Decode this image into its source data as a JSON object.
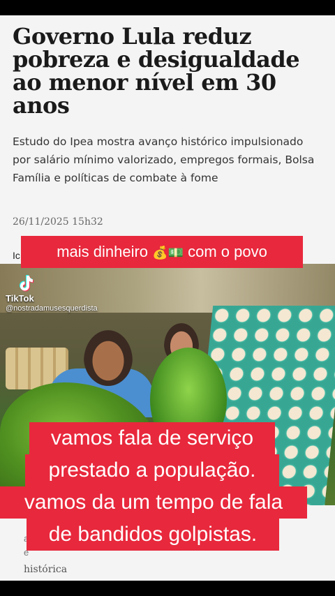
{
  "article": {
    "headline": "Governo Lula reduz pobreza e desigualdade ao menor nível em 30 anos",
    "subtitle": "Estudo do Ipea mostra avanço histórico impulsionado por salário mínimo valorizado, empregos formais, Bolsa Família e políticas de combate à fome",
    "date": "26/11/2025 15h32",
    "truncated_left": "Ic",
    "lower_text_fragment": "histórica"
  },
  "overlay": {
    "top_caption_pre": "mais dinheiro ",
    "top_caption_emoji": "💰💵",
    "top_caption_post": " com o povo",
    "caption_lines": [
      "vamos fala de serviço",
      "prestado a população.",
      "vamos da um tempo de fala",
      "de bandidos golpistas."
    ]
  },
  "watermark": {
    "brand": "TikTok",
    "handle": "@nostradamusesquerdista"
  },
  "colors": {
    "caption_bg": "#e8283c",
    "caption_text": "#ffffff",
    "article_bg": "#f4f4f4"
  }
}
